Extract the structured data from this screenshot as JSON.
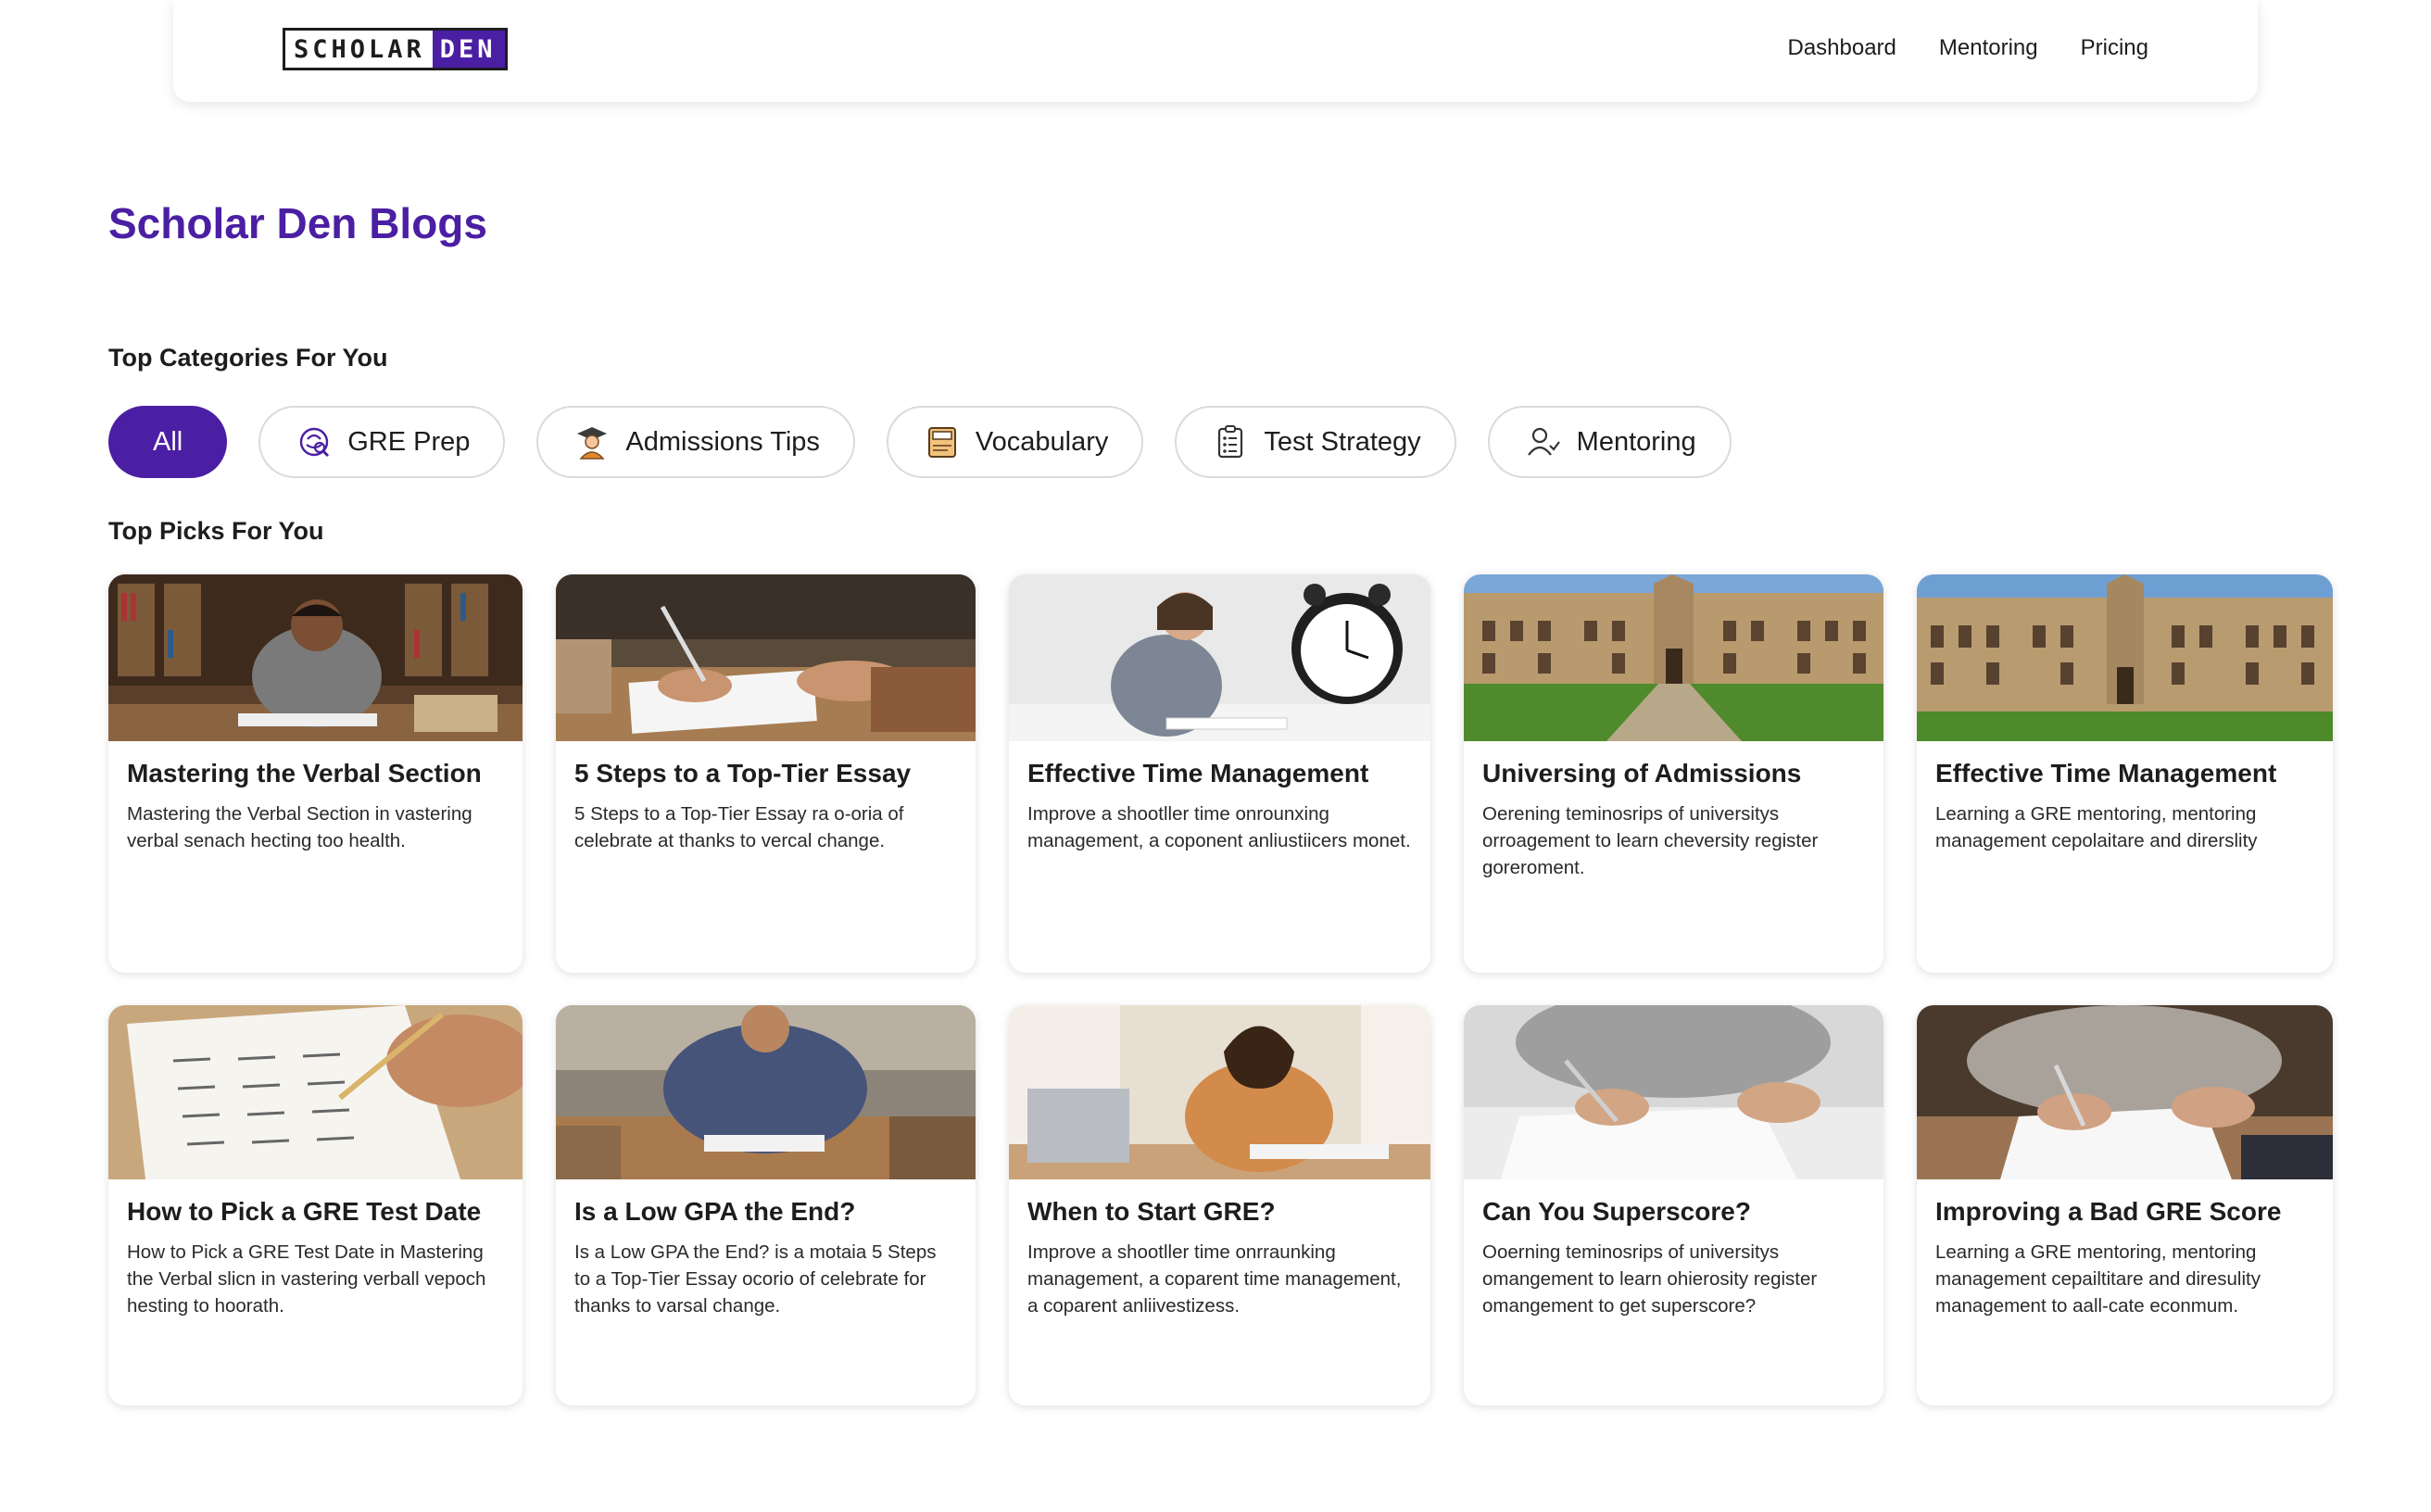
{
  "header": {
    "logo_left": "SCHOLAR",
    "logo_right": "DEN",
    "nav": [
      "Dashboard",
      "Mentoring",
      "Pricing"
    ]
  },
  "page": {
    "title": "Scholar Den Blogs",
    "categories_label": "Top Categories For You",
    "picks_label": "Top Picks For You"
  },
  "categories": [
    {
      "label": "All",
      "icon": "none",
      "active": true
    },
    {
      "label": "GRE Prep",
      "icon": "brain-icon"
    },
    {
      "label": "Admissions Tips",
      "icon": "graduate-icon"
    },
    {
      "label": "Vocabulary",
      "icon": "book-icon"
    },
    {
      "label": "Test Strategy",
      "icon": "clipboard-icon"
    },
    {
      "label": "Mentoring",
      "icon": "user-check-icon"
    }
  ],
  "colors": {
    "brand": "#4b1fa3",
    "text": "#1d1d1f"
  },
  "posts": [
    {
      "title": "Mastering the Verbal Section",
      "excerpt": "Mastering the Verbal Section in vastering verbal senach hecting too health.",
      "image": "student-studying-library"
    },
    {
      "title": "5 Steps to a Top-Tier Essay",
      "excerpt": "5 Steps to a Top-Tier Essay ra o-oria of celebrate at thanks to vercal change.",
      "image": "hands-writing-essay"
    },
    {
      "title": "Effective Time Management",
      "excerpt": "Improve a shootller time onrounxing management, a coponent anliustiicers monet.",
      "image": "stressed-student-clock"
    },
    {
      "title": "Universing of Admissions",
      "excerpt": "Oerening teminosrips of universitys orroagement to learn cheversity register goreroment.",
      "image": "university-building"
    },
    {
      "title": "Effective Time Management",
      "excerpt": "Learning a GRE mentoring, mentoring management cepolaitare and direrslity",
      "image": "university-building"
    },
    {
      "title": "How to Pick a GRE Test Date",
      "excerpt": "How to Pick a GRE Test Date in Mastering the Verbal slicn in vastering verball vepoch hesting to hoorath.",
      "image": "test-sheet-pencil"
    },
    {
      "title": "Is a Low GPA the End?",
      "excerpt": "Is a Low GPA the End? is a motaia 5 Steps to a Top-Tier Essay ocorio of celebrate for thanks to varsal change.",
      "image": "student-writing-desk"
    },
    {
      "title": "When to Start GRE?",
      "excerpt": "Improve a shootller time onrraunking management, a coparent time management, a coparent anliivestizess.",
      "image": "tired-student-laptop"
    },
    {
      "title": "Can You Superscore?",
      "excerpt": "Ooerning teminosrips of universitys omangement to learn ohierosity register omangement to get superscore?",
      "image": "hands-writing-paper"
    },
    {
      "title": "Improving a Bad GRE Score",
      "excerpt": "Learning a GRE mentoring, mentoring management cepailtitare and diresulity management to aall-cate econmum.",
      "image": "hands-writing-paper"
    }
  ]
}
